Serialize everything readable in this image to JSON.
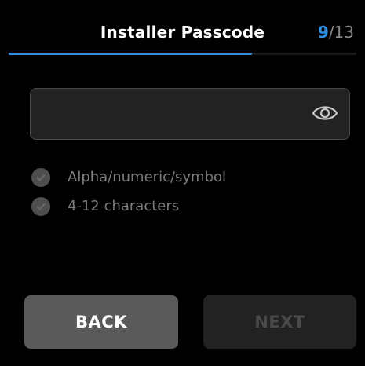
{
  "header": {
    "title": "Installer Passcode",
    "step_current": "9",
    "step_separator": "/",
    "step_total": "13",
    "progress_fraction": 0.7,
    "accent_color": "#2f8fe0"
  },
  "passcode_field": {
    "value": "",
    "visibility_icon": "eye-icon"
  },
  "requirements": [
    {
      "label": "Alpha/numeric/symbol",
      "icon": "check-icon"
    },
    {
      "label": "4-12 characters",
      "icon": "check-icon"
    }
  ],
  "buttons": {
    "back_label": "BACK",
    "next_label": "NEXT"
  }
}
